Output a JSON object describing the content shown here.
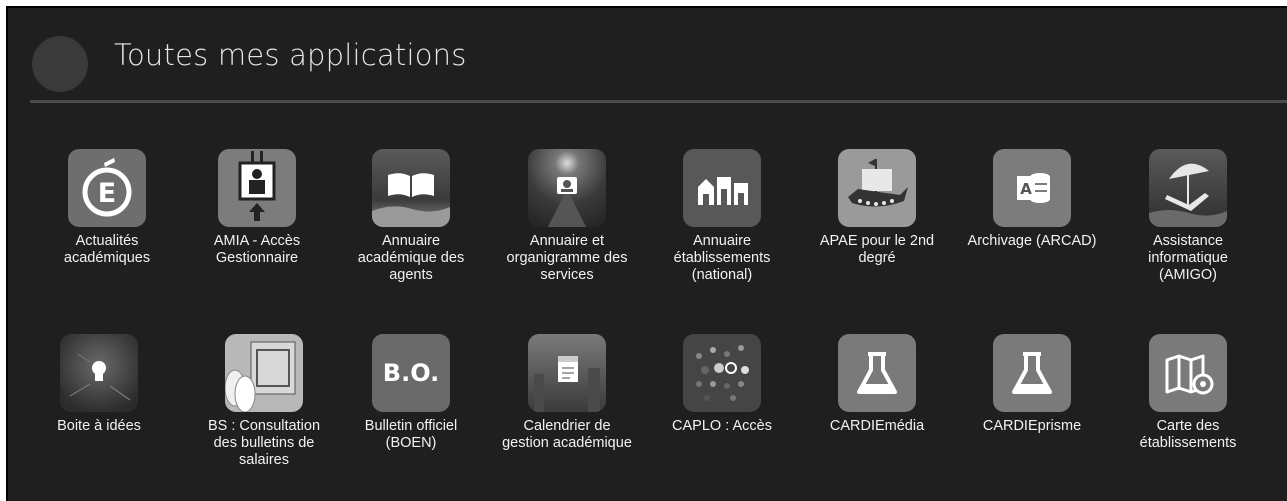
{
  "header": {
    "title": "Toutes mes applications"
  },
  "apps": [
    {
      "label": "Actualités académiques",
      "icon": "e-accent-icon"
    },
    {
      "label": "AMIA - Accès Gestionnaire",
      "icon": "elevator-icon"
    },
    {
      "label": "Annuaire académique des agents",
      "icon": "open-book-icon"
    },
    {
      "label": "Annuaire et organigramme des services",
      "icon": "contact-card-icon"
    },
    {
      "label": "Annuaire établissements (national)",
      "icon": "buildings-icon"
    },
    {
      "label": "APAE pour le 2nd degré",
      "icon": "viking-ship-icon"
    },
    {
      "label": "Archivage (ARCAD)",
      "icon": "access-database-icon"
    },
    {
      "label": "Assistance informatique (AMIGO)",
      "icon": "umbrella-chair-icon"
    },
    {
      "label": "Boite à idées",
      "icon": "lightbulb-icon"
    },
    {
      "label": "BS : Consultation des bulletins de salaires",
      "icon": "payslip-icon"
    },
    {
      "label": "Bulletin officiel (BOEN)",
      "icon": "bo-logo-icon",
      "logo_text": "B.O."
    },
    {
      "label": "Calendrier de gestion académique",
      "icon": "calendar-city-icon"
    },
    {
      "label": "CAPLO : Accès",
      "icon": "dots-pattern-icon"
    },
    {
      "label": "CARDIEmédia",
      "icon": "flask-icon"
    },
    {
      "label": "CARDIEprisme",
      "icon": "flask-icon"
    },
    {
      "label": "Carte des établissements",
      "icon": "map-pin-icon"
    }
  ]
}
